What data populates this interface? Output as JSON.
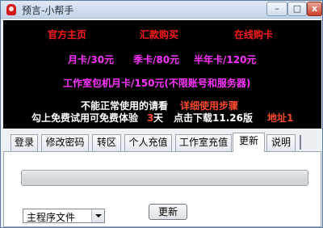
{
  "window": {
    "title": "预言-小帮手",
    "min_label": "–",
    "max_label": "□",
    "close_label": "x"
  },
  "banner": {
    "row1": [
      "官方主页",
      "汇款购买",
      "在线购卡"
    ],
    "row2": [
      "月卡/30元",
      "季卡/80元",
      "半年卡/120元"
    ],
    "row3": "工作室包机月卡/150元(不限账号和服务器)",
    "row4_prefix": "不能正常使用的请看",
    "row4_link": "详细使用步骤",
    "row5_part1": "勾上免费试用可免费体验",
    "row5_days": "3",
    "row5_part2": "天",
    "row5_download": "点击下载11.26版",
    "row5_link": "地址1"
  },
  "tabs": [
    {
      "label": "登录"
    },
    {
      "label": "修改密码"
    },
    {
      "label": "转区"
    },
    {
      "label": "个人充值"
    },
    {
      "label": "工作室充值"
    },
    {
      "label": "更新",
      "active": true
    },
    {
      "label": "说明"
    }
  ],
  "update_panel": {
    "progress_fraction": 0,
    "file_select_value": "主程序文件",
    "update_button_label": "更新"
  },
  "colors": {
    "banner_bg": "#000000",
    "red": "#ff1a1a",
    "magenta": "#ff33ff",
    "white": "#ffffff",
    "progress": "#35c84a"
  }
}
